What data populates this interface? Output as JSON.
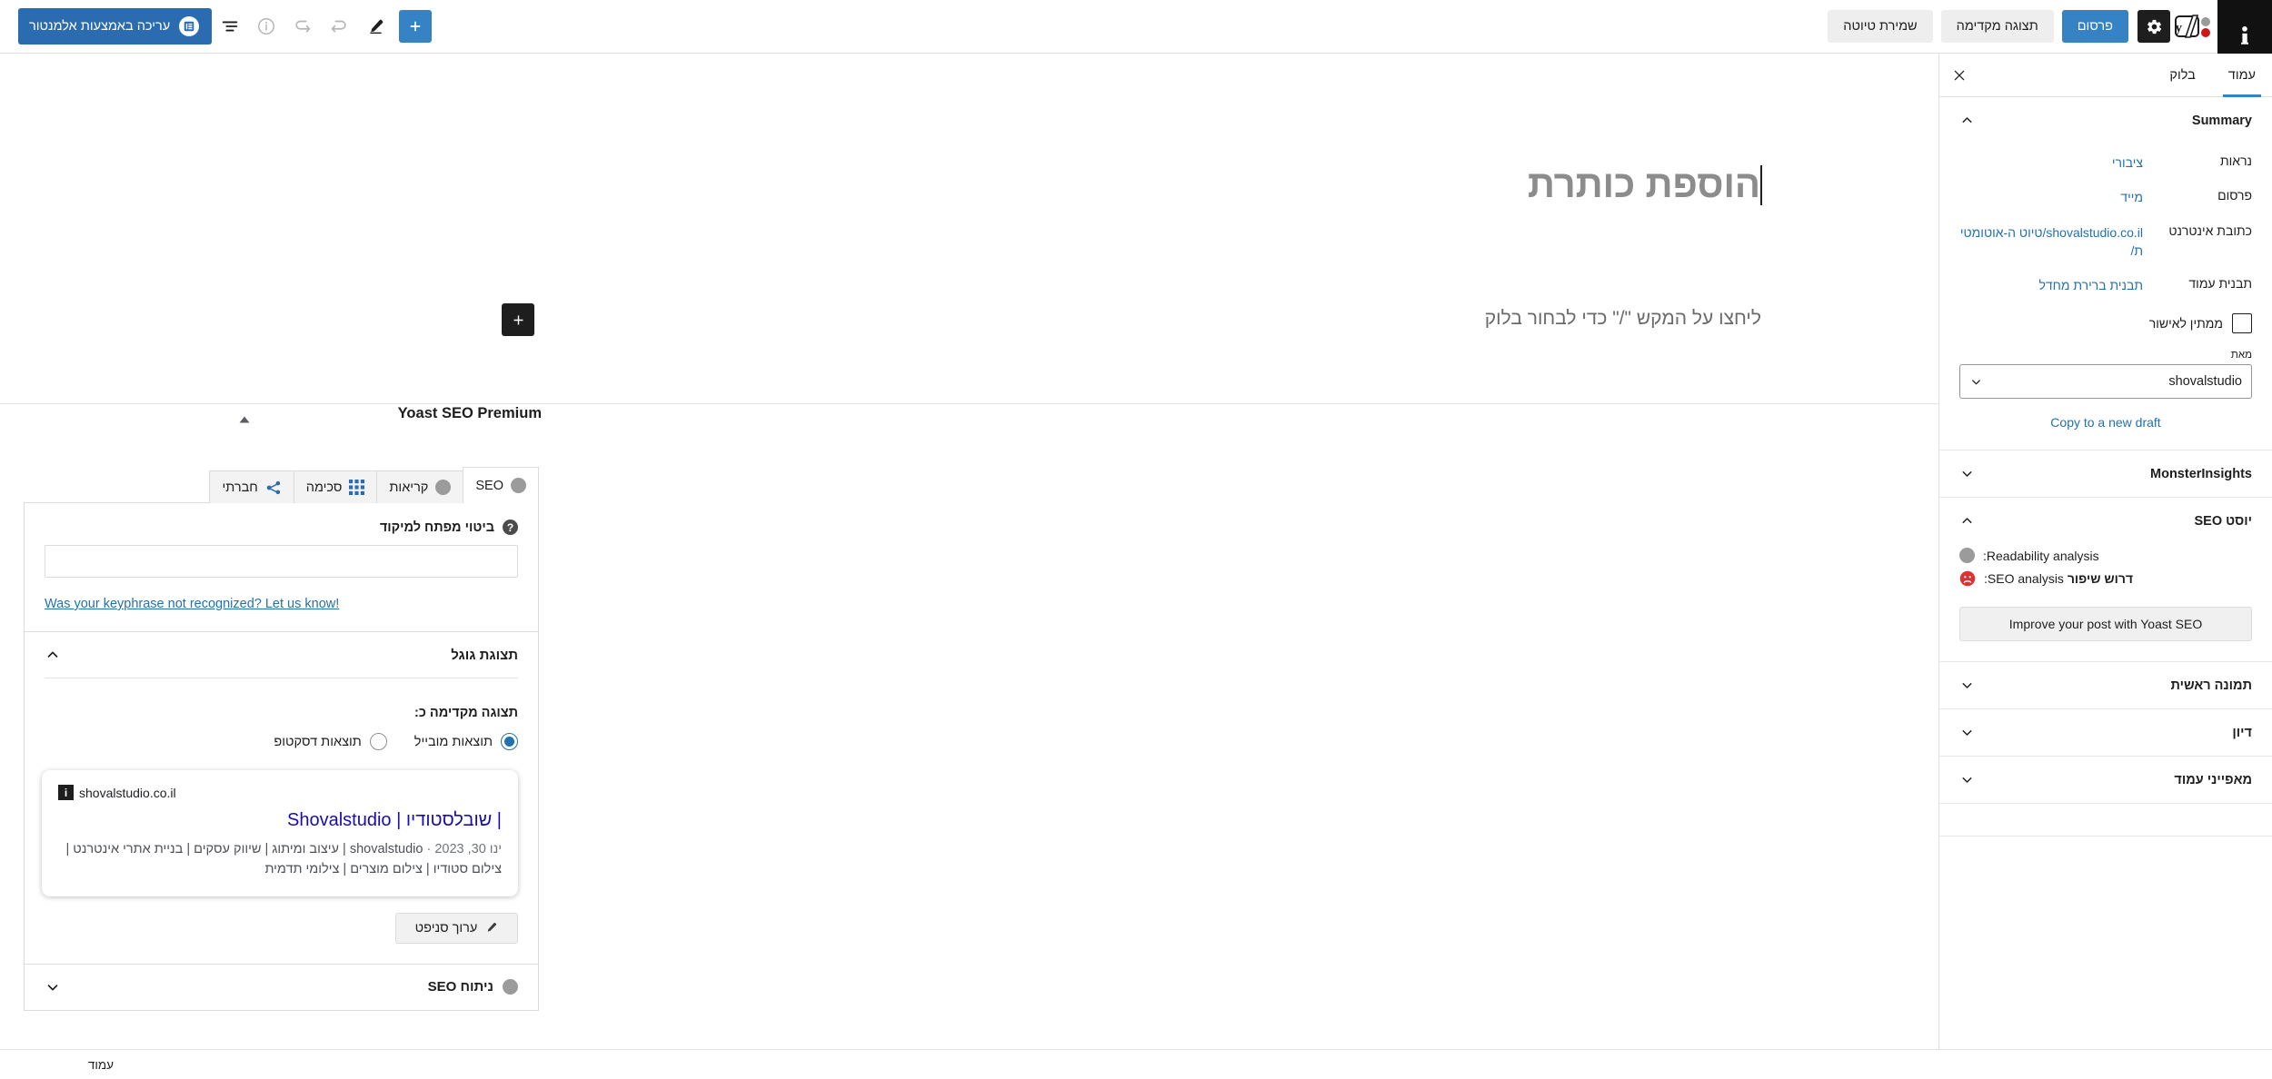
{
  "topbar": {
    "options_icon": "kebab-vertical-icon",
    "yoast_logo_icon": "yoast-logo-icon",
    "settings_gear_icon": "gear-icon",
    "publish_label": "פרסום",
    "preview_label": "תצוגה מקדימה",
    "save_draft_label": "שמירת טיוטה",
    "elementor_label": "עריכה באמצעות אלמנטור",
    "elementor_badge_icon": "elementor-icon",
    "list_view_icon": "list-view-icon",
    "info_icon": "info-circle-icon",
    "undo_icon": "undo-arrow-icon",
    "redo_icon": "redo-arrow-icon",
    "pencil_icon": "pencil-edit-icon",
    "add_block_icon": "plus-icon",
    "notice_icon": "info-bold-icon"
  },
  "sidebar": {
    "tabs": [
      {
        "label": "עמוד",
        "active": true
      },
      {
        "label": "בלוק",
        "active": false
      }
    ],
    "close_icon": "close-x-icon",
    "sections": [
      {
        "title": "Summary",
        "expanded": true,
        "chevron": "chevron-up-icon",
        "rows": [
          {
            "label": "נראות",
            "value": "ציבורי"
          },
          {
            "label": "פרסום",
            "value": "מייד"
          },
          {
            "label": "כתובת אינטרנט",
            "value": "shovalstudio.co.il/טיוט ה-אוטומטית/"
          },
          {
            "label": "תבנית עמוד",
            "value": "תבנית ברירת מחדל"
          }
        ],
        "pending_review": {
          "label": "ממתין לאישור",
          "checked": false
        },
        "author": {
          "label": "מאת",
          "value": "shovalstudio",
          "chevron": "chevron-down-icon"
        },
        "copy_draft_link": "Copy to a new draft"
      },
      {
        "title": "MonsterInsights",
        "expanded": false,
        "chevron": "chevron-down-icon"
      },
      {
        "title": "יוסט SEO",
        "expanded": true,
        "chevron": "chevron-up-icon",
        "readability": {
          "label": "Readability analysis:",
          "dot_color": "#9b9b9b"
        },
        "seo_analysis": {
          "label": "SEO analysis:",
          "value": "דרוש שיפור",
          "face_icon": "sad-face-icon",
          "face_color": "#dc3232"
        },
        "improve_button": "Improve your post with Yoast SEO"
      },
      {
        "title": "תמונה ראשית",
        "expanded": false,
        "chevron": "chevron-down-icon"
      },
      {
        "title": "דיון",
        "expanded": false,
        "chevron": "chevron-down-icon"
      },
      {
        "title": "מאפייני עמוד",
        "expanded": false,
        "chevron": "chevron-down-icon"
      }
    ]
  },
  "editor": {
    "title_value": "הוספת כותרת",
    "body_placeholder": "ליחצו על המקש \"/\" כדי לבחור בלוק",
    "inserter_icon": "plus-icon"
  },
  "yoast": {
    "panel_title": "Yoast SEO Premium",
    "collapse_icon": "triangle-up-icon",
    "tabs": [
      {
        "label": "SEO",
        "active": true,
        "icon": "status-dot-icon",
        "dot_color": "#9b9b9b"
      },
      {
        "label": "קריאות",
        "active": false,
        "icon": "status-dot-icon",
        "dot_color": "#9b9b9b"
      },
      {
        "label": "סכימה",
        "active": false,
        "icon": "schema-grid-icon"
      },
      {
        "label": "חברתי",
        "active": false,
        "icon": "share-icon"
      }
    ],
    "keyphrase": {
      "label": "ביטוי מפתח למיקוד",
      "help_icon": "question-mark-icon",
      "value": "",
      "placeholder": "",
      "not_recognized_link": "Was your keyphrase not recognized? Let us know!"
    },
    "google_preview": {
      "title": "תצוגת גוגל",
      "chevron": "chevron-up-icon",
      "preview_as_label": "תצוגה מקדימה כ:",
      "options": [
        {
          "label": "תוצאות מובייל",
          "selected": true
        },
        {
          "label": "תוצאות דסקטופ",
          "selected": false
        }
      ],
      "snippet": {
        "url": "shovalstudio.co.il",
        "info_badge": "i",
        "title": "| שובלסטודיו | Shovalstudio",
        "date": "ינו 30, 2023",
        "description": "shovalstudio | עיצוב ומיתוג | שיווק עסקים | בניית אתרי אינטרנט | צילום סטודיו | צילום מוצרים | צילומי תדמית"
      },
      "edit_snippet_button": {
        "label": "ערוך סניפט",
        "icon": "pencil-edit-icon"
      }
    },
    "seo_analysis_section": {
      "title": "ניתוח SEO",
      "chevron": "chevron-down-icon",
      "dot_color": "#9b9b9b"
    }
  },
  "statusbar": {
    "label": "עמוד"
  },
  "colors": {
    "accent_blue": "#3582c4",
    "link_blue": "#2271b1",
    "elementor_blue": "#2b6cb0",
    "google_link": "#1a0dab",
    "error_red": "#dc3232",
    "neutral_grey": "#9b9b9b"
  }
}
